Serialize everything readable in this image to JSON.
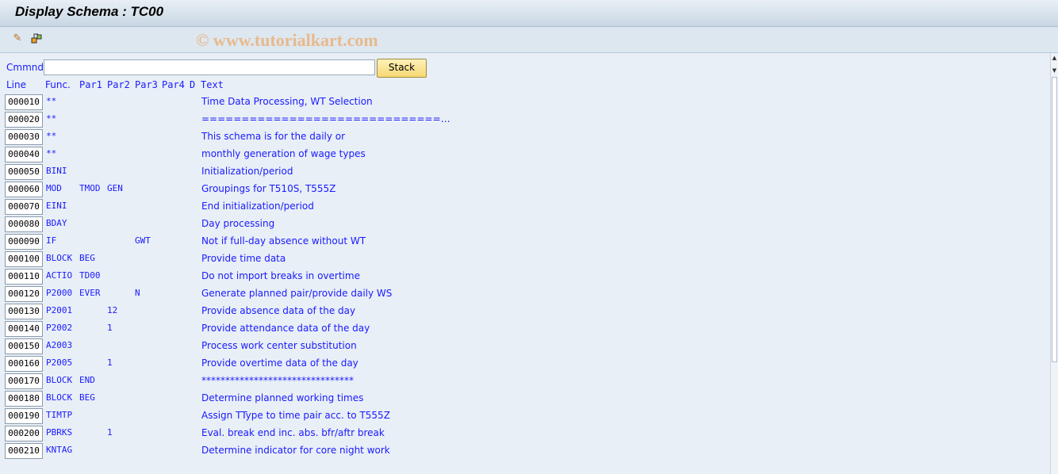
{
  "title": "Display Schema : TC00",
  "toolbar": {
    "icons": [
      "change-icon",
      "other-object-icon"
    ]
  },
  "watermark": "© www.tutorialkart.com",
  "command": {
    "label": "Cmmnd",
    "value": "",
    "stack_label": "Stack"
  },
  "headers": {
    "line": "Line",
    "func": "Func.",
    "par1": "Par1",
    "par2": "Par2",
    "par3": "Par3",
    "par4": "Par4",
    "d": "D",
    "text": "Text"
  },
  "rows": [
    {
      "line": "000010",
      "func": "**",
      "par1": "",
      "par2": "",
      "par3": "",
      "par4": "",
      "d": "",
      "text": "Time Data Processing, WT Selection"
    },
    {
      "line": "000020",
      "func": "**",
      "par1": "",
      "par2": "",
      "par3": "",
      "par4": "",
      "d": "",
      "text": "==============================…"
    },
    {
      "line": "000030",
      "func": "**",
      "par1": "",
      "par2": "",
      "par3": "",
      "par4": "",
      "d": "",
      "text": "This schema is for the daily or"
    },
    {
      "line": "000040",
      "func": "**",
      "par1": "",
      "par2": "",
      "par3": "",
      "par4": "",
      "d": "",
      "text": "monthly generation of wage types"
    },
    {
      "line": "000050",
      "func": "BINI",
      "par1": "",
      "par2": "",
      "par3": "",
      "par4": "",
      "d": "",
      "text": "Initialization/period"
    },
    {
      "line": "000060",
      "func": "MOD",
      "par1": "TMOD",
      "par2": "GEN",
      "par3": "",
      "par4": "",
      "d": "",
      "text": "Groupings for T510S, T555Z"
    },
    {
      "line": "000070",
      "func": "EINI",
      "par1": "",
      "par2": "",
      "par3": "",
      "par4": "",
      "d": "",
      "text": "End initialization/period"
    },
    {
      "line": "000080",
      "func": "BDAY",
      "par1": "",
      "par2": "",
      "par3": "",
      "par4": "",
      "d": "",
      "text": "Day processing"
    },
    {
      "line": "000090",
      "func": "IF",
      "par1": "",
      "par2": "",
      "par3": "GWT",
      "par4": "",
      "d": "",
      "text": "Not if full-day absence without WT"
    },
    {
      "line": "000100",
      "func": "BLOCK",
      "par1": "BEG",
      "par2": "",
      "par3": "",
      "par4": "",
      "d": "",
      "text": "Provide time data"
    },
    {
      "line": "000110",
      "func": "ACTIO",
      "par1": "TD00",
      "par2": "",
      "par3": "",
      "par4": "",
      "d": "",
      "text": "Do not import breaks in overtime"
    },
    {
      "line": "000120",
      "func": "P2000",
      "par1": "EVER",
      "par2": "",
      "par3": "N",
      "par4": "",
      "d": "",
      "text": "Generate planned pair/provide daily WS"
    },
    {
      "line": "000130",
      "func": "P2001",
      "par1": "",
      "par2": "12",
      "par3": "",
      "par4": "",
      "d": "",
      "text": "Provide absence data of the day"
    },
    {
      "line": "000140",
      "func": "P2002",
      "par1": "",
      "par2": "1",
      "par3": "",
      "par4": "",
      "d": "",
      "text": "Provide attendance data of the day"
    },
    {
      "line": "000150",
      "func": "A2003",
      "par1": "",
      "par2": "",
      "par3": "",
      "par4": "",
      "d": "",
      "text": "Process work center substitution"
    },
    {
      "line": "000160",
      "func": "P2005",
      "par1": "",
      "par2": "1",
      "par3": "",
      "par4": "",
      "d": "",
      "text": "Provide overtime data of the day"
    },
    {
      "line": "000170",
      "func": "BLOCK",
      "par1": "END",
      "par2": "",
      "par3": "",
      "par4": "",
      "d": "",
      "text": "********************************"
    },
    {
      "line": "000180",
      "func": "BLOCK",
      "par1": "BEG",
      "par2": "",
      "par3": "",
      "par4": "",
      "d": "",
      "text": "Determine planned working times"
    },
    {
      "line": "000190",
      "func": "TIMTP",
      "par1": "",
      "par2": "",
      "par3": "",
      "par4": "",
      "d": "",
      "text": "Assign TType to time pair acc. to T555Z"
    },
    {
      "line": "000200",
      "func": "PBRKS",
      "par1": "",
      "par2": "1",
      "par3": "",
      "par4": "",
      "d": "",
      "text": "Eval. break end inc. abs. bfr/aftr break"
    },
    {
      "line": "000210",
      "func": "KNTAG",
      "par1": "",
      "par2": "",
      "par3": "",
      "par4": "",
      "d": "",
      "text": "Determine indicator for core night work"
    }
  ]
}
